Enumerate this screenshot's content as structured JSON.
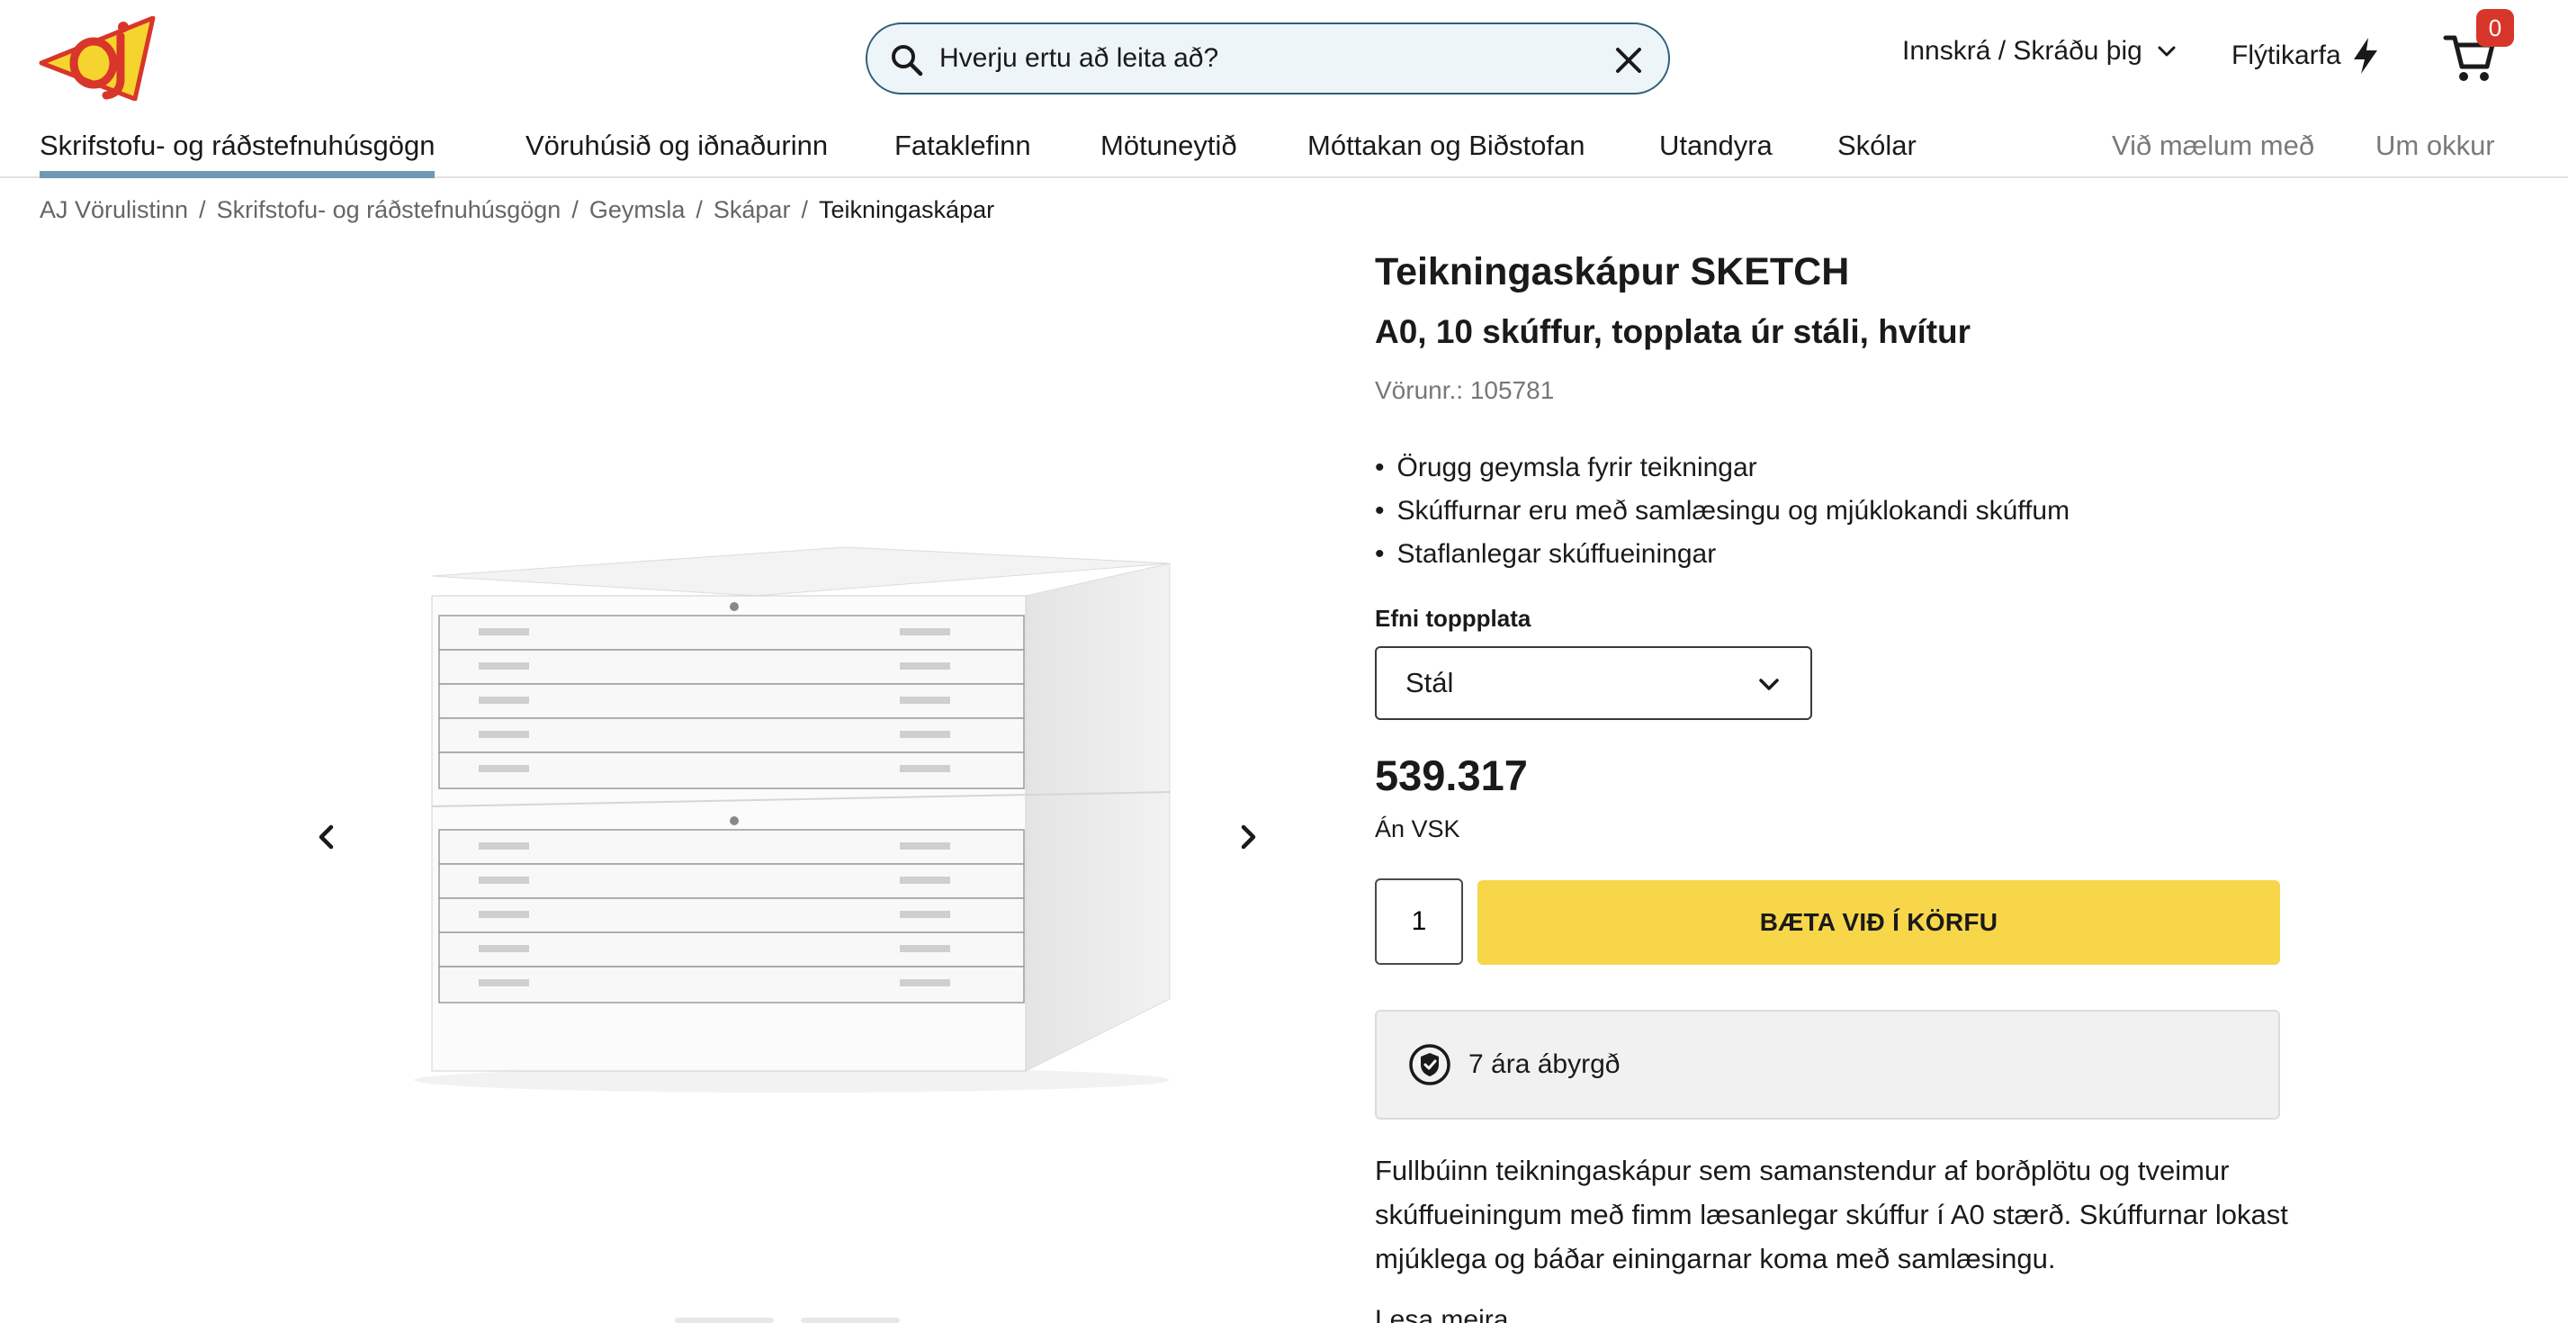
{
  "header": {
    "logo_alt": "AJ",
    "search": {
      "placeholder": "Hverju ertu að leita að?"
    },
    "login_label": "Innskrá / Skráðu þig",
    "quick_cart_label": "Flýtikarfa",
    "cart_count": "0"
  },
  "nav": {
    "items": [
      {
        "label": "Skrifstofu- og ráðstefnuhúsgögn"
      },
      {
        "label": "Vöruhúsið og iðnaðurinn"
      },
      {
        "label": "Fataklefinn"
      },
      {
        "label": "Mötuneytið"
      },
      {
        "label": "Móttakan og Biðstofan"
      },
      {
        "label": "Utandyra"
      },
      {
        "label": "Skólar"
      }
    ],
    "secondary": [
      {
        "label": "Við mælum með"
      },
      {
        "label": "Um okkur"
      }
    ]
  },
  "breadcrumb": [
    {
      "label": "AJ Vörulistinn"
    },
    {
      "label": "Skrifstofu- og ráðstefnuhúsgögn"
    },
    {
      "label": "Geymsla"
    },
    {
      "label": "Skápar"
    },
    {
      "label": "Teikningaskápar"
    }
  ],
  "product": {
    "title": "Teikningaskápur SKETCH",
    "subtitle": "A0, 10 skúffur, topplata úr stáli, hvítur",
    "sku": "Vörunr.: 105781",
    "bullets": [
      "Örugg geymsla fyrir teikningar",
      "Skúffurnar eru með samlæsingu og mjúklokandi skúffum",
      "Staflanlegar skúffueiningar"
    ],
    "option_label": "Efni toppplata",
    "option_value": "Stál",
    "price": "539.317",
    "vat_note": "Án VSK",
    "quantity": "1",
    "add_to_cart_label": "BÆTA VIÐ Í KÖRFU",
    "warranty": "7 ára ábyrgð",
    "description": "Fullbúinn teikningaskápur sem samanstendur af borðplötu og tveimur skúffueiningum með fimm læsanlegar skúffur í A0 stærð. Skúffurnar lokast mjúklega og báðar einingarnar koma með samlæsingu.",
    "read_more": "Lesa meira"
  },
  "colors": {
    "accent_underline": "#6f9ab4",
    "search_border": "#2f5f7a",
    "search_bg": "#eef5f9",
    "add_button": "#f7d64a",
    "cart_badge": "#d8362b",
    "logo_yellow": "#f6d42e",
    "logo_red": "#d8362b"
  },
  "icons": {
    "search": "search-icon",
    "clear": "close-icon",
    "login_chevron": "chevron-down-icon",
    "quick_cart": "lightning-icon",
    "cart": "shopping-cart-icon",
    "prev": "chevron-left-icon",
    "next": "chevron-right-icon",
    "select_chevron": "chevron-down-icon",
    "warranty": "shield-check-icon"
  }
}
